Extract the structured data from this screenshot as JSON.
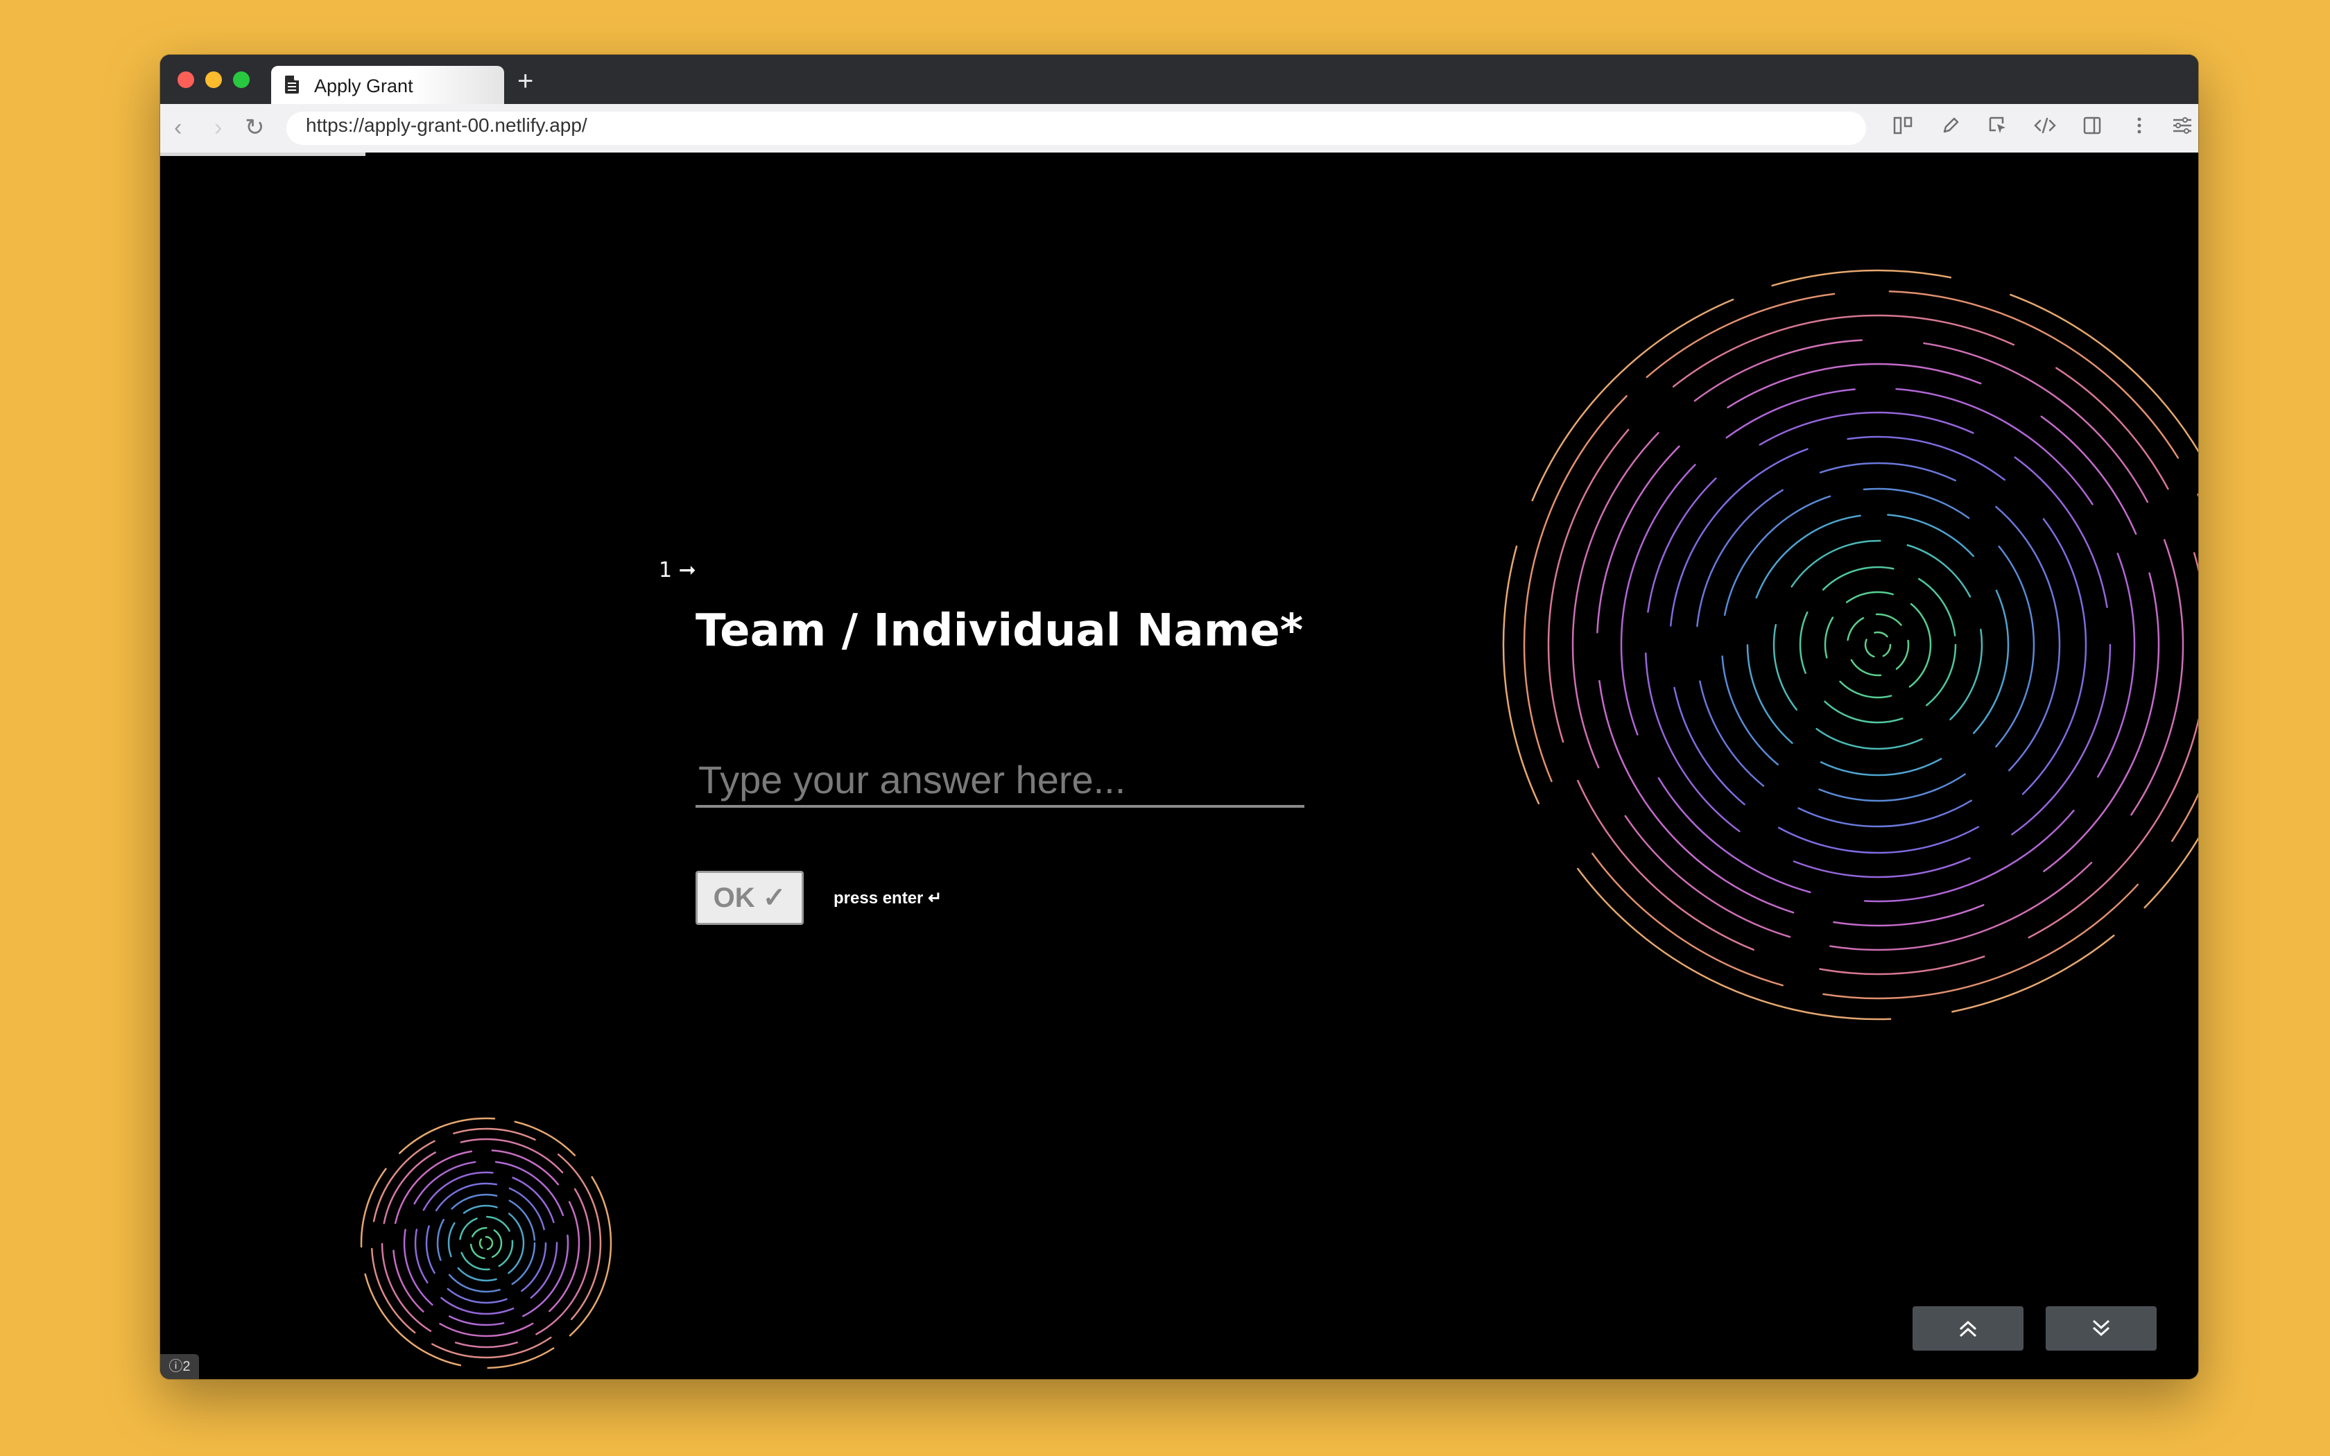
{
  "browser": {
    "tab_title": "Apply Grant",
    "new_tab_label": "+",
    "url": "https://apply-grant-00.netlify.app/",
    "nav": {
      "back": "‹",
      "forward": "›",
      "reload": "↻"
    }
  },
  "form": {
    "question_number": "1 ➞",
    "question_title": "Team / Individual Name*",
    "answer_placeholder": "Type your answer here...",
    "answer_value": "",
    "ok_label": "OK ✓",
    "press_enter_label": "press enter ↵"
  },
  "page_nav": {
    "up_label": "︽",
    "down_label": "︾"
  },
  "badge": {
    "label": "ⓘ2"
  },
  "colors": {
    "page_background": "#000000",
    "desktop_background": "#F2BA45",
    "nav_button": "#4A4F54",
    "ok_button": "#ECECEC"
  }
}
